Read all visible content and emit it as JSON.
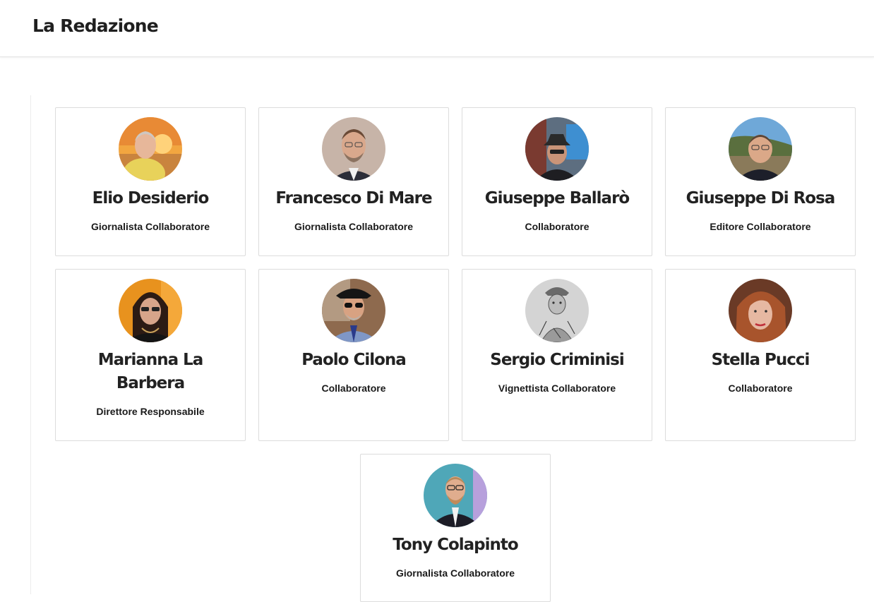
{
  "header": {
    "title": "La Redazione"
  },
  "members": [
    {
      "name": "Elio Desiderio",
      "role": "Giornalista Collaboratore",
      "avatar_icon": "elio-desiderio-avatar"
    },
    {
      "name": "Francesco Di Mare",
      "role": "Giornalista Collaboratore",
      "avatar_icon": "francesco-di-mare-avatar"
    },
    {
      "name": "Giuseppe Ballarò",
      "role": "Collaboratore",
      "avatar_icon": "giuseppe-ballaro-avatar"
    },
    {
      "name": "Giuseppe Di Rosa",
      "role": "Editore Collaboratore",
      "avatar_icon": "giuseppe-di-rosa-avatar"
    },
    {
      "name": "Marianna La Barbera",
      "role": "Direttore Responsabile",
      "avatar_icon": "marianna-la-barbera-avatar"
    },
    {
      "name": "Paolo Cilona",
      "role": "Collaboratore",
      "avatar_icon": "paolo-cilona-avatar"
    },
    {
      "name": "Sergio Criminisi",
      "role": "Vignettista Collaboratore",
      "avatar_icon": "sergio-criminisi-avatar"
    },
    {
      "name": "Stella Pucci",
      "role": "Collaboratore",
      "avatar_icon": "stella-pucci-avatar"
    },
    {
      "name": "Tony Colapinto",
      "role": "Giornalista Collaboratore",
      "avatar_icon": "tony-colapinto-avatar"
    }
  ]
}
